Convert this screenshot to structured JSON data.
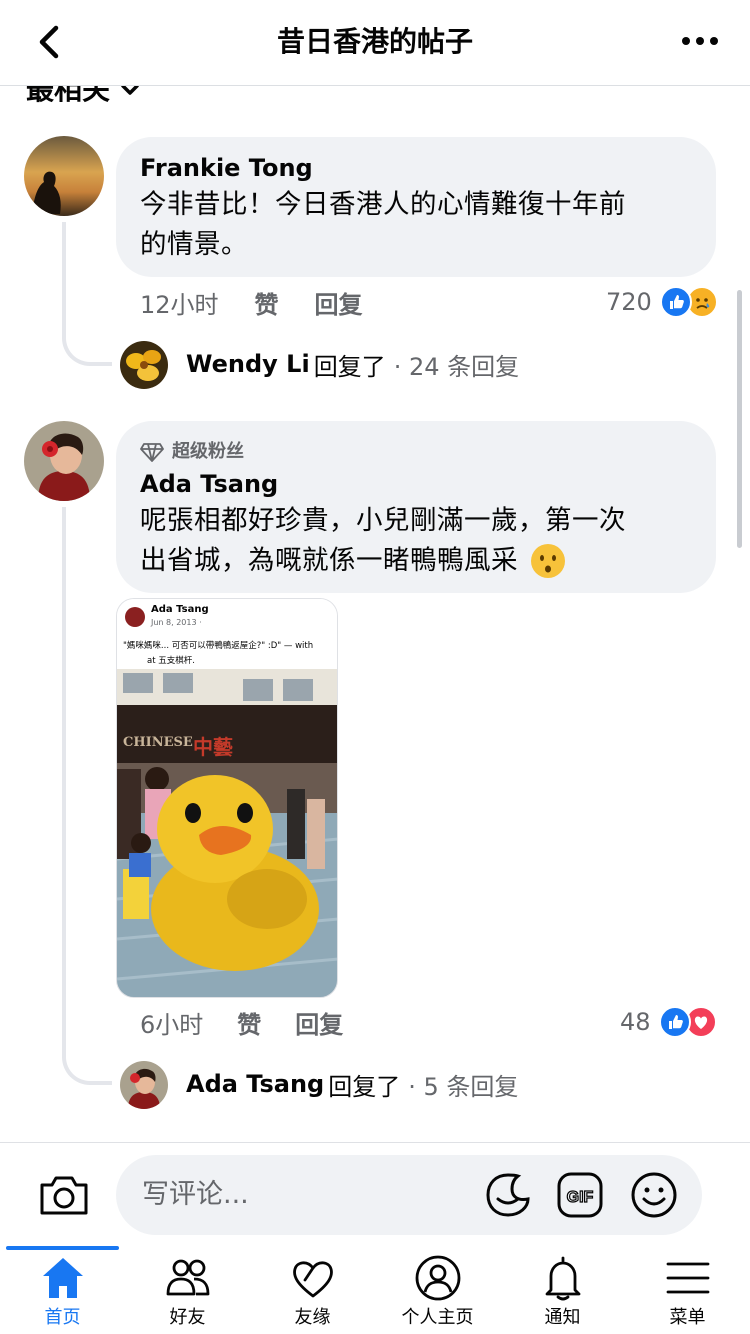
{
  "header": {
    "title": "昔日香港的帖子"
  },
  "sort": {
    "label": "最相关"
  },
  "comments": [
    {
      "author": "Frankie Tong",
      "text_line1": "今非昔比！今日香港人的心情難復十年前",
      "text_line2": "的情景。",
      "time": "12小时",
      "like": "赞",
      "reply": "回复",
      "reaction_count": "720",
      "reply_summary": {
        "name": "Wendy Li",
        "action": "回复了",
        "count": "· 24 条回复"
      }
    },
    {
      "badge": "超级粉丝",
      "author": "Ada Tsang",
      "text_line1": "呢張相都好珍貴，小兒剛滿一歲，第一次",
      "text_line2": "出省城，為嘅就係一睹鴨鴨風采",
      "time": "6小时",
      "like": "赞",
      "reply": "回复",
      "reaction_count": "48",
      "reply_summary": {
        "name": "Ada Tsang",
        "action": "回复了",
        "count": "· 5 条回复"
      },
      "photo": {
        "post_author": "Ada Tsang",
        "post_date": "Jun 8, 2013 · ",
        "post_text_line1": "\"媽咪媽咪... 可否可以帶鴨鴨返屋企?\" :D\" — with",
        "post_text_line2": "at 五支棋杆.",
        "shop_sign": "CHINESE",
        "shop_sign_cn": "中藝"
      }
    }
  ],
  "compose": {
    "placeholder": "写评论..."
  },
  "tabs": [
    {
      "label": "首页",
      "icon": "home-icon"
    },
    {
      "label": "好友",
      "icon": "friends-icon"
    },
    {
      "label": "友缘",
      "icon": "dating-heart-icon"
    },
    {
      "label": "个人主页",
      "icon": "profile-icon"
    },
    {
      "label": "通知",
      "icon": "bell-icon"
    },
    {
      "label": "菜单",
      "icon": "menu-icon"
    }
  ],
  "colors": {
    "accent": "#1877f2",
    "like": "#1877f2",
    "love": "#f33e58",
    "bubble": "#f0f2f5",
    "secondary_text": "#65676b"
  }
}
